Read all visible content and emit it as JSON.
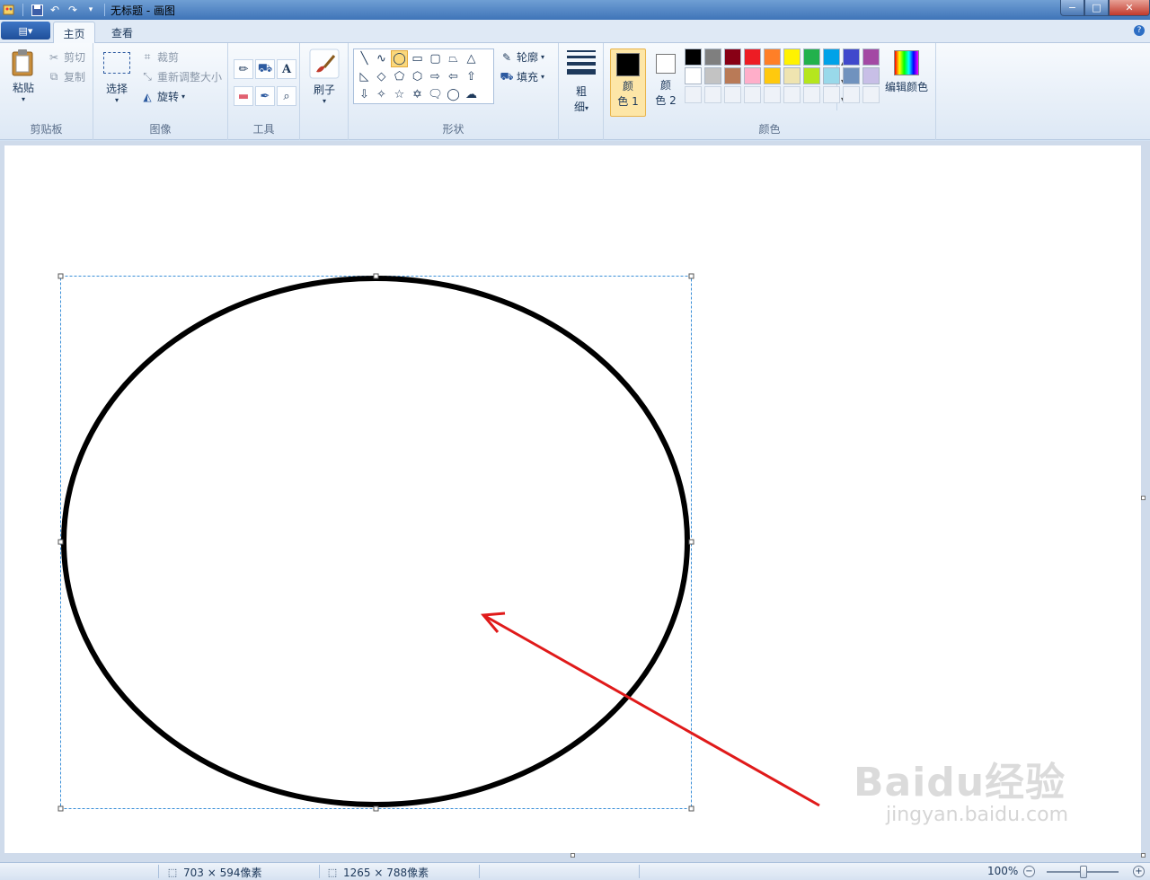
{
  "window": {
    "title": "无标题 - 画图",
    "controls": {
      "minimize": "−",
      "maximize": "□",
      "close": "✕"
    }
  },
  "quick_access": {
    "save_icon": "save-icon",
    "undo_icon": "undo-icon",
    "redo_icon": "redo-icon"
  },
  "tabs": {
    "app_menu": "▤▾",
    "home": "主页",
    "view": "查看",
    "help": "?"
  },
  "clipboard": {
    "paste": "粘贴",
    "cut": "剪切",
    "copy": "复制",
    "label": "剪贴板"
  },
  "image": {
    "select": "选择",
    "crop": "裁剪",
    "resize": "重新调整大小",
    "rotate": "旋转",
    "label": "图像"
  },
  "tools": {
    "label": "工具",
    "text_tool": "A"
  },
  "brushes": {
    "label": "刷子"
  },
  "shapes": {
    "outline": "轮廓",
    "fill": "填充",
    "label": "形状",
    "selected": "oval"
  },
  "size": {
    "line1": "粗",
    "line2": "细"
  },
  "colors": {
    "color1_line1": "颜",
    "color1_line2": "色 1",
    "color2_line1": "颜",
    "color2_line2": "色 2",
    "edit": "编辑颜色",
    "label": "颜色",
    "color1": "#000000",
    "color2": "#ffffff",
    "palette_row1": [
      "#000000",
      "#7f7f7f",
      "#880015",
      "#ed1c24",
      "#ff7f27",
      "#fff200",
      "#22b14c",
      "#00a2e8",
      "#3f48cc",
      "#a349a4"
    ],
    "palette_row2": [
      "#ffffff",
      "#c3c3c3",
      "#b97a57",
      "#ffaec9",
      "#ffc90e",
      "#efe4b0",
      "#b5e61d",
      "#99d9ea",
      "#7092be",
      "#c8bfe7"
    ]
  },
  "status": {
    "selection_size": "703 × 594像素",
    "canvas_size": "1265 × 788像素",
    "zoom": "100%"
  },
  "watermark": {
    "main": "Baidu经验",
    "sub": "jingyan.baidu.com"
  }
}
